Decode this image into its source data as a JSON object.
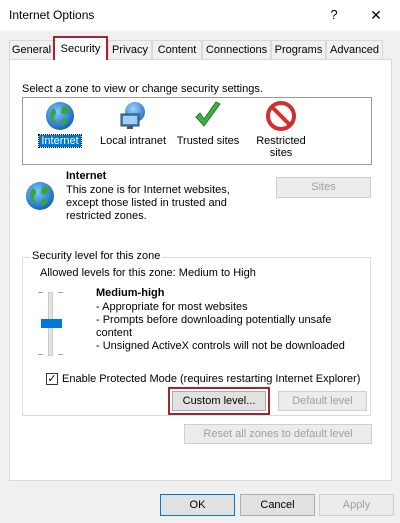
{
  "window": {
    "title": "Internet Options",
    "help": "?",
    "close": "✕"
  },
  "tabs": [
    {
      "label": "General"
    },
    {
      "label": "Security"
    },
    {
      "label": "Privacy"
    },
    {
      "label": "Content"
    },
    {
      "label": "Connections"
    },
    {
      "label": "Programs"
    },
    {
      "label": "Advanced"
    }
  ],
  "zones": {
    "prompt": "Select a zone to view or change security settings.",
    "items": [
      {
        "label": "Internet",
        "icon": "globe-icon"
      },
      {
        "label": "Local intranet",
        "icon": "network-computer-icon"
      },
      {
        "label": "Trusted sites",
        "icon": "green-checkmark-icon"
      },
      {
        "label": "Restricted",
        "label2": "sites",
        "icon": "no-entry-icon"
      }
    ],
    "selected": "Internet"
  },
  "zone_info": {
    "title": "Internet",
    "description": "This zone is for Internet websites, except those listed in trusted and restricted zones.",
    "sites_button": "Sites"
  },
  "security_level": {
    "group_label": "Security level for this zone",
    "allowed": "Allowed levels for this zone: Medium to High",
    "level_name": "Medium-high",
    "bullets": [
      "- Appropriate for most websites",
      "- Prompts before downloading potentially unsafe",
      "  content",
      "- Unsigned ActiveX controls will not be downloaded"
    ],
    "slider_level_fraction": 0.5
  },
  "protected_mode": {
    "label": "Enable Protected Mode (requires restarting Internet Explorer)",
    "checked": true,
    "check_glyph": "✓"
  },
  "buttons": {
    "custom_level": "Custom level...",
    "default_level": "Default level",
    "reset_all": "Reset all zones to default level",
    "ok": "OK",
    "cancel": "Cancel",
    "apply": "Apply"
  },
  "colors": {
    "highlight_border": "#a4262c",
    "selection": "#0078d7",
    "dialog_bg": "#f0f0f0"
  }
}
